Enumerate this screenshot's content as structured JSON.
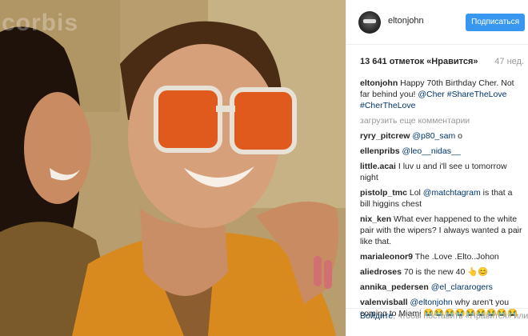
{
  "photo": {
    "watermark": "corbis"
  },
  "header": {
    "username": "eltonjohn",
    "follow_label": "Подписаться"
  },
  "stats": {
    "likes": "13 641 отметок «Нравится»",
    "time": "47 нед."
  },
  "caption": {
    "user": "eltonjohn",
    "text": "Happy 70th Birthday Cher. Not far behind you!",
    "mention": "@Cher",
    "hashtags": "#ShareTheLove #CherTheLove"
  },
  "load_more": "загрузить еще комментарии",
  "comments": [
    {
      "user": "ryry_pitcrew",
      "mention": "@p80_sam",
      "text": "o"
    },
    {
      "user": "ellenpribs",
      "mention": "@leo__nidas__",
      "text": ""
    },
    {
      "user": "little.acai",
      "mention": "",
      "text": "I luv u and i'll see u tomorrow night"
    },
    {
      "user": "pistolp_tmc",
      "pre": "Lol",
      "mention": "@matchtagram",
      "text": "is that a bill higgins chest"
    },
    {
      "user": "nix_ken",
      "mention": "",
      "text": "What ever happened to the white pair with the wipers? I always wanted a pair like that."
    },
    {
      "user": "marialeonor9",
      "mention": "",
      "text": "The .Love .Elto..Johon"
    },
    {
      "user": "aliedroses",
      "mention": "",
      "text": "70 is the new 40 👆😊"
    },
    {
      "user": "annika_pedersen",
      "mention": "@el_clararogers",
      "text": ""
    },
    {
      "user": "valenvisball",
      "mention": "@eltonjohn",
      "text": "why aren't you coming to Miami 😭😭😭😭😭😭😭😭😭😭😭😭😭😭😭"
    }
  ],
  "footer": {
    "login_link": "Войдите",
    "text": ", чтобы поставить «Нравится» или"
  },
  "colors": {
    "accent": "#3897f0",
    "link": "#003569"
  }
}
